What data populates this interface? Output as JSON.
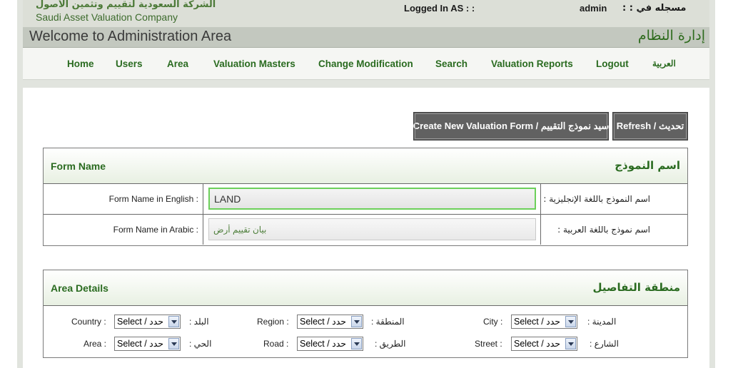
{
  "header": {
    "logo_ar": "الشركة السعودية لتقييم وتثمين الأصول",
    "logo_en": "Saudi Asset Valuation Company",
    "logged_in_label": "Logged In AS : :",
    "user": "admin",
    "logged_in_label_ar": "مسجله في : :",
    "welcome_en": "Welcome to Administration Area",
    "welcome_ar": "إدارة النظام"
  },
  "nav": {
    "items": [
      "Home",
      "Users",
      "Area",
      "Valuation Masters",
      "Change Modification",
      "Search",
      "Valuation Reports",
      "Logout"
    ],
    "lang_toggle": "العربية"
  },
  "actions": {
    "create_label": "Create New Valuation Form / سيد نموذج التقييم",
    "refresh_label": "Refresh / تحديث"
  },
  "form_name": {
    "title_en": "Form Name",
    "title_ar": "اسم النموذج",
    "english_label": "Form Name in English :",
    "english_label_ar": "اسم النموذج باللغة الإنجليزية :",
    "english_value": "LAND",
    "arabic_label": "Form Name in Arabic :",
    "arabic_label_ar": "اسم نموذج باللغة العربية :",
    "arabic_value": "بيان تقييم أرض"
  },
  "area_details": {
    "title_en": "Area Details",
    "title_ar": "منطقة التفاصيل",
    "select_default": "Select / حدد",
    "fields": {
      "country": {
        "en": "Country :",
        "ar": "البلد :"
      },
      "region": {
        "en": "Region :",
        "ar": "المنطقة :"
      },
      "city": {
        "en": "City :",
        "ar": "المدينة :"
      },
      "area": {
        "en": "Area :",
        "ar": "الحي :"
      },
      "road": {
        "en": "Road :",
        "ar": "الطريق :"
      },
      "street": {
        "en": "Street :",
        "ar": "الشارع :"
      }
    }
  }
}
